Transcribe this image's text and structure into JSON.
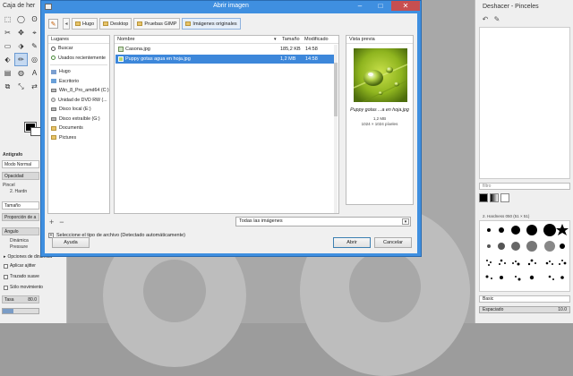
{
  "toolbox": {
    "title": "Caja de her",
    "tools": [
      "⬚",
      "◯",
      "ʘ",
      "✂",
      "✥",
      "⌖",
      "▭",
      "⬗",
      "✎",
      "⬖",
      "✏",
      "◎",
      "▤",
      "◍",
      "A",
      "⧉",
      "⤡",
      "⇄"
    ],
    "options_title": "Antigrafo",
    "mode_label": "Modo",
    "mode_value": "Normal",
    "opacity_label": "Opacidad",
    "brush_label": "Pincel",
    "brush_value": "2. Hardn",
    "size_label": "Tamaño",
    "ratio_label": "Proporción de a",
    "angle_label": "Ángulo",
    "dynamics_label": "Dinámica",
    "dynamics_value": "Pressure",
    "dyn_options_label": "Opciones de dinámica",
    "apply_jitter_label": "Aplicar ajitter",
    "smooth_label": "Trazado suave",
    "lock_label": "Sólo movimiento",
    "rate_label": "Tasa",
    "rate_value": "80.0"
  },
  "right_panel": {
    "title": "Deshacer - Pinceles",
    "filter_placeholder": "filtro",
    "brush_name": "2. Hardness 050 (51 × 51)",
    "preset": "Basic",
    "spacing_label": "Espaciado",
    "spacing_value": "10.0"
  },
  "dialog": {
    "title": "Abrir imagen",
    "breadcrumbs": [
      "Hugo",
      "Desktop",
      "Pruebas GIMP",
      "Imágenes originales"
    ],
    "places_header": "Lugares",
    "places": [
      {
        "icon": "search",
        "label": "Buscar"
      },
      {
        "icon": "recent",
        "label": "Usados recientemente"
      },
      {
        "sep": true
      },
      {
        "icon": "home",
        "label": "Hugo"
      },
      {
        "icon": "desk",
        "label": "Escritorio"
      },
      {
        "icon": "drive",
        "label": "Win_8_Pro_amd64 (C:)"
      },
      {
        "icon": "disc",
        "label": "Unidad de DVD RW (..."
      },
      {
        "icon": "drive",
        "label": "Disco local (E:)"
      },
      {
        "icon": "drive",
        "label": "Disco extraíble (G:)"
      },
      {
        "icon": "folder",
        "label": "Documents"
      },
      {
        "icon": "folder",
        "label": "Pictures"
      }
    ],
    "columns": {
      "name": "Nombre",
      "size": "Tamaño",
      "modified": "Modificado"
    },
    "files": [
      {
        "name": "Casona.jpg",
        "size": "185,2 KB",
        "modified": "14:58",
        "selected": false
      },
      {
        "name": "Puppy gotas agua en hoja.jpg",
        "size": "1,2 MB",
        "modified": "14:58",
        "selected": true
      }
    ],
    "preview": {
      "header": "Vista previa",
      "name": "Puppy gotas ...a en hoja.jpg",
      "size": "1,2 MB",
      "dims": "1024 × 1024 píxeles"
    },
    "filter_value": "Todas las imágenes",
    "file_type_label": "Seleccione el tipo de archivo (Detectado automáticamente)",
    "buttons": {
      "help": "Ayuda",
      "open": "Abrir",
      "cancel": "Cancelar"
    },
    "accent": "#3f8fe0"
  }
}
